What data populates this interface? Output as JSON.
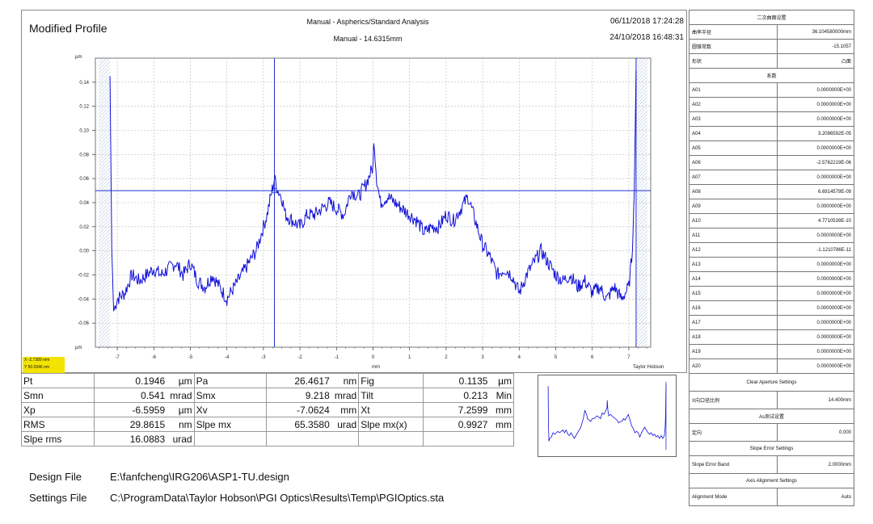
{
  "header": {
    "title": "Modified Profile",
    "analysis": "Manual - Aspherics/Standard Analysis",
    "subtitle": "Manual - 14.6315mm",
    "date1": "06/11/2018 17:24:28",
    "date2": "24/10/2018 16:48:31"
  },
  "chart_data": {
    "type": "line",
    "xlabel": "mm",
    "ylabel": "µm",
    "xlim": [
      -7.6,
      7.6
    ],
    "ylim": [
      -0.08,
      0.16
    ],
    "x_ticks": [
      "-7",
      "-6",
      "-5",
      "-4",
      "-3",
      "-2",
      "-1",
      "0",
      "1",
      "2",
      "3",
      "4",
      "5",
      "6",
      "7"
    ],
    "y_ticks": [
      "0.14",
      "0.12",
      "0.10",
      "0.08",
      "0.06",
      "0.04",
      "0.02",
      "0.00",
      "-0.02",
      "-0.04",
      "-0.06"
    ],
    "cursor_x": -2.7,
    "cursor_y": 0.05,
    "aperture": [
      -7.2,
      7.2
    ],
    "watermark": "Taylor Hobson",
    "series": [
      {
        "x": [
          -7.2,
          -7.15,
          -7.1,
          -7.0,
          -6.8,
          -6.6,
          -6.4,
          -6.2,
          -6.0,
          -5.8,
          -5.6,
          -5.4,
          -5.2,
          -5.0,
          -4.8,
          -4.6,
          -4.4,
          -4.2,
          -4.0,
          -3.8,
          -3.6,
          -3.4,
          -3.2,
          -3.0,
          -2.9,
          -2.8,
          -2.7,
          -2.6,
          -2.5,
          -2.4,
          -2.2,
          -2.0,
          -1.8,
          -1.6,
          -1.4,
          -1.2,
          -1.0,
          -0.8,
          -0.6,
          -0.4,
          -0.2,
          0.0,
          0.02,
          0.1,
          0.2,
          0.4,
          0.6,
          0.8,
          1.0,
          1.2,
          1.4,
          1.6,
          1.8,
          2.0,
          2.2,
          2.4,
          2.6,
          2.8,
          3.0,
          3.2,
          3.4,
          3.6,
          3.8,
          4.0,
          4.2,
          4.4,
          4.6,
          4.8,
          5.0,
          5.2,
          5.4,
          5.6,
          5.8,
          6.0,
          6.2,
          6.4,
          6.6,
          6.8,
          7.0,
          7.1,
          7.15,
          7.2
        ],
        "y": [
          0.145,
          0.0,
          -0.05,
          -0.04,
          -0.035,
          -0.02,
          -0.025,
          -0.02,
          -0.015,
          -0.02,
          -0.015,
          -0.01,
          -0.02,
          -0.01,
          -0.025,
          -0.03,
          -0.02,
          -0.03,
          -0.04,
          -0.03,
          -0.02,
          -0.01,
          0.0,
          0.02,
          0.03,
          0.045,
          0.06,
          0.05,
          0.045,
          0.03,
          0.025,
          0.02,
          0.03,
          0.03,
          0.035,
          0.04,
          0.035,
          0.03,
          0.05,
          0.045,
          0.055,
          0.07,
          0.095,
          0.06,
          0.04,
          0.045,
          0.04,
          0.035,
          0.03,
          0.025,
          0.015,
          0.02,
          0.02,
          0.03,
          0.025,
          0.035,
          0.045,
          0.025,
          0.005,
          -0.005,
          -0.02,
          -0.015,
          -0.02,
          -0.035,
          -0.02,
          -0.01,
          0.0,
          -0.01,
          -0.02,
          -0.025,
          -0.02,
          -0.03,
          -0.025,
          -0.035,
          -0.03,
          -0.04,
          -0.03,
          -0.04,
          -0.03,
          0.0,
          0.05,
          0.15
        ]
      }
    ]
  },
  "cursor_readout": {
    "line1": "X -2.7389 mm",
    "line2": "Y 50.0346 nm"
  },
  "params": [
    [
      "Pt",
      "0.1946",
      "µm",
      "Pa",
      "26.4617",
      "nm",
      "Fig",
      "0.1135",
      "µm"
    ],
    [
      "Smn",
      "0.541",
      "mrad",
      "Smx",
      "9.218",
      "mrad",
      "Tilt",
      "0.213",
      "Min"
    ],
    [
      "Xp",
      "-6.5959",
      "µm",
      "Xv",
      "-7.0624",
      "mm",
      "Xt",
      "7.2599",
      "mm"
    ],
    [
      "RMS",
      "29.8615",
      "nm",
      "Slpe mx",
      "65.3580",
      "urad",
      "Slpe mx(x)",
      "0.9927",
      "mm"
    ],
    [
      "Slpe rms",
      "16.0883",
      "urad",
      "",
      "",
      "",
      "",
      "",
      ""
    ]
  ],
  "files": {
    "design_label": "Design File",
    "design_path": "E:\\fanfcheng\\IRG206\\ASP1-TU.design",
    "settings_label": "Settings File",
    "settings_path": "C:\\ProgramData\\Taylor Hobson\\PGI Optics\\Results\\Temp\\PGIOptics.sta"
  },
  "right_panel": {
    "rows": [
      {
        "label": "二次曲面设置",
        "value": "",
        "header": true
      },
      {
        "label": "曲率半径",
        "value": "36.104580000mm"
      },
      {
        "label": "圆锥常数",
        "value": "-15.1057"
      },
      {
        "label": "形状",
        "value": "凸面"
      },
      {
        "label": "系数",
        "value": "",
        "header": true
      },
      {
        "label": "A01",
        "value": "0.0000000E+00"
      },
      {
        "label": "A02",
        "value": "0.0000000E+00"
      },
      {
        "label": "A03",
        "value": "0.0000000E+00"
      },
      {
        "label": "A04",
        "value": "3.2086592E-05"
      },
      {
        "label": "A05",
        "value": "0.0000000E+00"
      },
      {
        "label": "A06",
        "value": "-2.5762219E-06"
      },
      {
        "label": "A07",
        "value": "0.0000000E+00"
      },
      {
        "label": "A08",
        "value": "6.6914579E-09"
      },
      {
        "label": "A09",
        "value": "0.0000000E+00"
      },
      {
        "label": "A10",
        "value": "4.7710539E-10"
      },
      {
        "label": "A11",
        "value": "0.0000000E+00"
      },
      {
        "label": "A12",
        "value": "-1.1210786E-11"
      },
      {
        "label": "A13",
        "value": "0.0000000E+00"
      },
      {
        "label": "A14",
        "value": "0.0000000E+00"
      },
      {
        "label": "A15",
        "value": "0.0000000E+00"
      },
      {
        "label": "A16",
        "value": "0.0000000E+00"
      },
      {
        "label": "A17",
        "value": "0.0000000E+00"
      },
      {
        "label": "A18",
        "value": "0.0000000E+00"
      },
      {
        "label": "A19",
        "value": "0.0000000E+00"
      },
      {
        "label": "A20",
        "value": "0.0000000E+00"
      },
      {
        "label": "Clear Aperture Settings",
        "value": "",
        "header": true,
        "gap": true
      },
      {
        "label": "X向口径比例",
        "value": "14.400mm",
        "gap": true
      },
      {
        "label": "As测试设置",
        "value": "",
        "header": true
      },
      {
        "label": "定向",
        "value": "0.000",
        "gap": true
      },
      {
        "label": "Slope Error Settings",
        "value": "",
        "header": true
      },
      {
        "label": "Slope Error Band",
        "value": "2.0000mm",
        "gap": true
      },
      {
        "label": "Axis Alignment Settings",
        "value": "",
        "header": true
      },
      {
        "label": "Alignment Mode",
        "value": "Auto",
        "gap": true
      }
    ]
  }
}
